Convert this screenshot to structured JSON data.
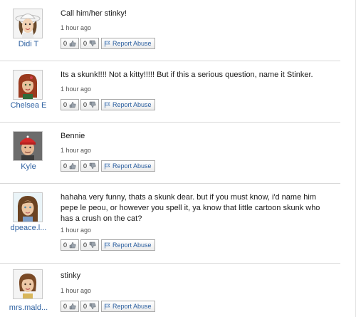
{
  "answers": [
    {
      "username": "Didi T",
      "avatar": "avatar-didi-white-hat",
      "text": "Call him/her stinky!",
      "time": "1 hour ago",
      "thumbs_up": "0",
      "thumbs_down": "0",
      "report_label": "Report Abuse"
    },
    {
      "username": "Chelsea E",
      "avatar": "avatar-chelsea-red-hair",
      "text": "Its a skunk!!!! Not a kitty!!!!! But if this a serious question, name it Stinker.",
      "time": "1 hour ago",
      "thumbs_up": "0",
      "thumbs_down": "0",
      "report_label": "Report Abuse"
    },
    {
      "username": "Kyle",
      "avatar": "avatar-kyle-red-cap",
      "text": "Bennie",
      "time": "1 hour ago",
      "thumbs_up": "0",
      "thumbs_down": "0",
      "report_label": "Report Abuse"
    },
    {
      "username": "dpeace.l...",
      "avatar": "avatar-dpeace-long-hair",
      "text": "hahaha very funny, thats a skunk dear. but if you must know, i'd name him pepe le peou, or however you spell it, ya know that little cartoon skunk who has a crush on the cat?",
      "time": "1 hour ago",
      "thumbs_up": "0",
      "thumbs_down": "0",
      "report_label": "Report Abuse"
    },
    {
      "username": "mrs.mald...",
      "avatar": "avatar-mrsmald-brown-hair",
      "text": "stinky",
      "time": "1 hour ago",
      "thumbs_up": "0",
      "thumbs_down": "0",
      "report_label": "Report Abuse"
    }
  ],
  "colors": {
    "link": "#2b5fa0",
    "divider": "#d8d8d8",
    "text": "#1a1a1a"
  },
  "icons": {
    "thumbs_up": "thumbs-up-icon",
    "thumbs_down": "thumbs-down-icon",
    "report": "flag-icon"
  }
}
